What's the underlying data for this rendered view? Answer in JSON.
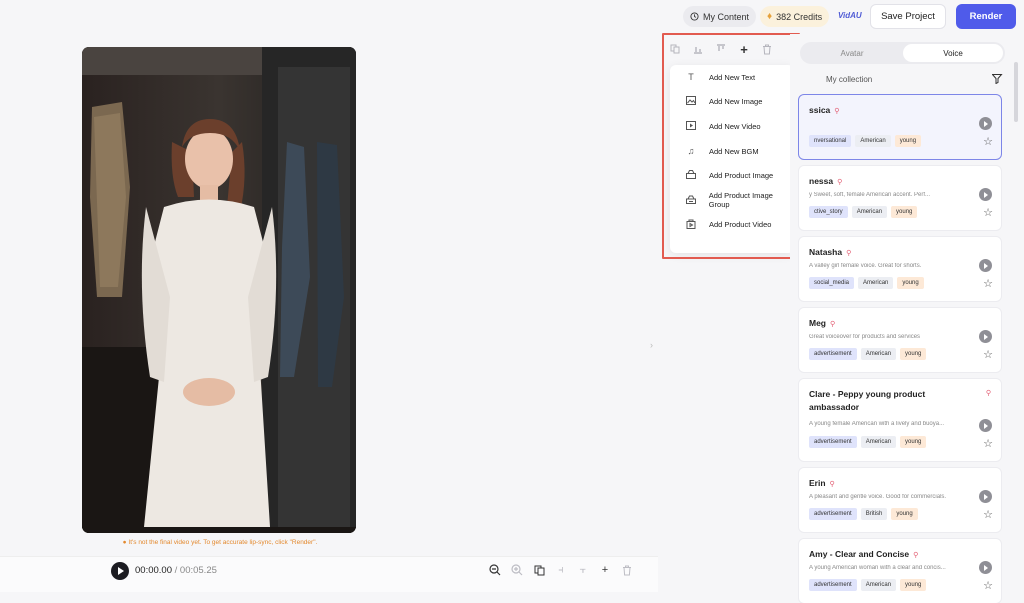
{
  "topbar": {
    "my_content": "My Content",
    "credits": "382 Credits",
    "brand": "VidAU",
    "save_label": "Save Project",
    "render_label": "Render"
  },
  "stage": {
    "note": "It's not the final video yet. To get accurate lip-sync, click \"Render\".",
    "time_current": "00:00.00",
    "time_sep": " / ",
    "time_total": "00:05.25"
  },
  "dropdown": {
    "items": [
      {
        "label": "Add New Text",
        "icon": "text-icon"
      },
      {
        "label": "Add New Image",
        "icon": "image-icon"
      },
      {
        "label": "Add New Video",
        "icon": "video-icon"
      },
      {
        "label": "Add New BGM",
        "icon": "music-icon"
      },
      {
        "label": "Add Product Image",
        "icon": "product-image-icon"
      },
      {
        "label": "Add Product Image Group",
        "icon": "product-image-group-icon"
      },
      {
        "label": "Add Product Video",
        "icon": "product-video-icon"
      }
    ]
  },
  "panel": {
    "tab_avatar": "Avatar",
    "tab_voice": "Voice",
    "collection": "My collection",
    "voices": [
      {
        "name": "ssica",
        "desc": "",
        "tags": [
          "nversational",
          "American",
          "young"
        ]
      },
      {
        "name": "nessa",
        "desc": "y Sweet, soft, female American accent. Perf...",
        "tags": [
          "ctive_story",
          "American",
          "young"
        ]
      },
      {
        "name": "Natasha",
        "desc": "A valley girl female voice. Great for shorts.",
        "tags": [
          "social_media",
          "American",
          "young"
        ]
      },
      {
        "name": "Meg",
        "desc": "Great voiceover for products and services",
        "tags": [
          "advertisement",
          "American",
          "young"
        ]
      },
      {
        "name": "Clare - Peppy young product ambassador",
        "desc": "A young female American with a lively and buoya...",
        "tags": [
          "advertisement",
          "American",
          "young"
        ]
      },
      {
        "name": "Erin",
        "desc": "A pleasant and gentle voice. Good for commercials.",
        "tags": [
          "advertisement",
          "British",
          "young"
        ]
      },
      {
        "name": "Amy - Clear and Concise",
        "desc": "A young American woman with a clear and concis...",
        "tags": [
          "advertisement",
          "American",
          "young"
        ]
      }
    ]
  },
  "colors": {
    "accent": "#4f5bea",
    "highlight": "#e25b50",
    "warning": "#e3892e"
  }
}
